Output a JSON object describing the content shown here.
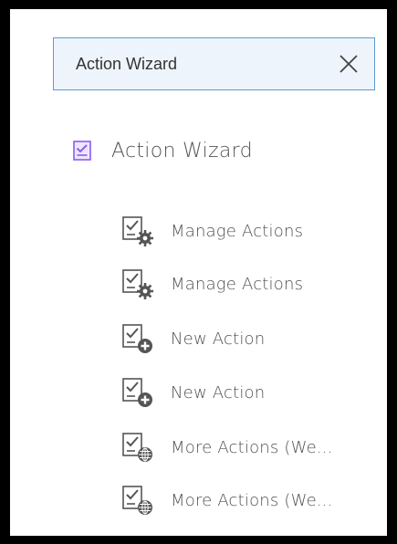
{
  "search": {
    "value": "Action Wizard",
    "clear_icon": "close-icon"
  },
  "tool": {
    "label": "Action Wizard",
    "icon": "action-wizard-icon",
    "accent_color": "#8a5cf0"
  },
  "actions": [
    {
      "label": "Manage Actions",
      "icon": "manage-actions-icon"
    },
    {
      "label": "Manage Actions",
      "icon": "manage-actions-icon"
    },
    {
      "label": "New Action",
      "icon": "new-action-icon"
    },
    {
      "label": "New Action",
      "icon": "new-action-icon"
    },
    {
      "label": "More Actions (We...",
      "icon": "more-actions-web-icon"
    },
    {
      "label": "More Actions (We...",
      "icon": "more-actions-web-icon"
    }
  ]
}
